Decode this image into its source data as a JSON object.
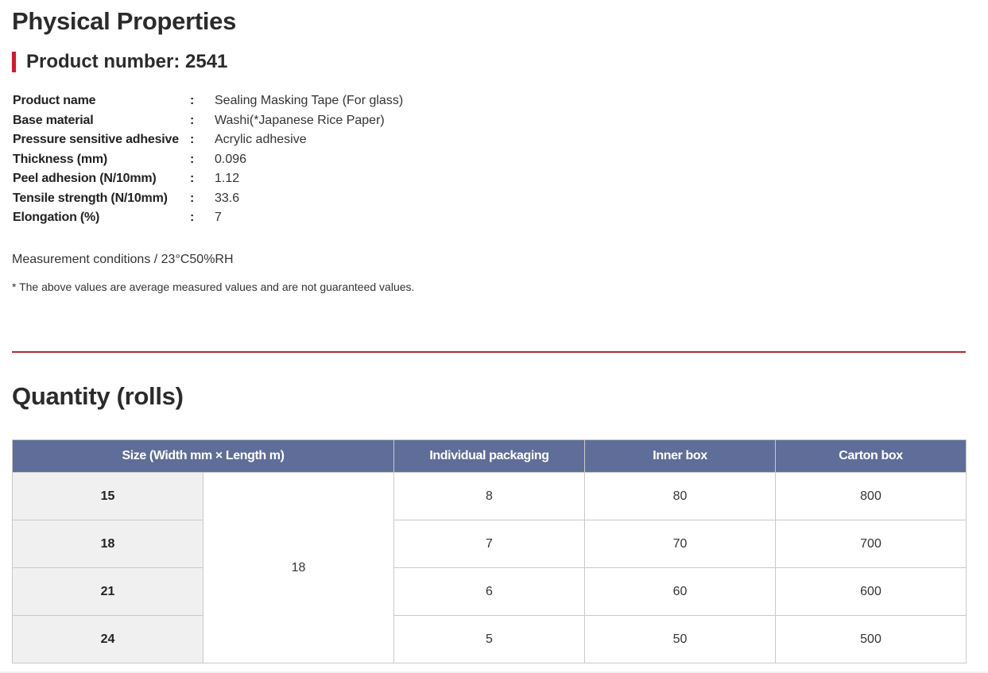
{
  "physical": {
    "title": "Physical Properties",
    "product_heading": "Product number: 2541",
    "properties": [
      {
        "label": "Product name",
        "separator": ":",
        "value": "Sealing Masking Tape (For glass)"
      },
      {
        "label": "Base material",
        "separator": ":",
        "value": "Washi(*Japanese Rice Paper)"
      },
      {
        "label": "Pressure sensitive adhesive",
        "separator": ":",
        "value": "Acrylic adhesive"
      },
      {
        "label": "Thickness (mm)",
        "separator": ":",
        "value": "0.096"
      },
      {
        "label": "Peel adhesion (N/10mm)",
        "separator": ":",
        "value": "1.12"
      },
      {
        "label": "Tensile strength (N/10mm)",
        "separator": ":",
        "value": "33.6"
      },
      {
        "label": "Elongation (%)",
        "separator": ":",
        "value": "7"
      }
    ],
    "measurement": "Measurement conditions / 23°C50%RH",
    "note": "* The above values are average measured values and are not guaranteed values."
  },
  "quantity": {
    "title": "Quantity (rolls)",
    "headers": {
      "size": "Size (Width mm × Length m)",
      "individual": "Individual packaging",
      "inner": "Inner box",
      "carton": "Carton box"
    },
    "length": "18",
    "rows": [
      {
        "width": "15",
        "individual": "8",
        "inner": "80",
        "carton": "800"
      },
      {
        "width": "18",
        "individual": "7",
        "inner": "70",
        "carton": "700"
      },
      {
        "width": "21",
        "individual": "6",
        "inner": "60",
        "carton": "600"
      },
      {
        "width": "24",
        "individual": "5",
        "inner": "50",
        "carton": "500"
      }
    ]
  },
  "colors": {
    "accent_red": "#d7172f",
    "divider": "#b3263a",
    "table_header": "#5f6e98",
    "width_cell_bg": "#f0f0f0"
  }
}
